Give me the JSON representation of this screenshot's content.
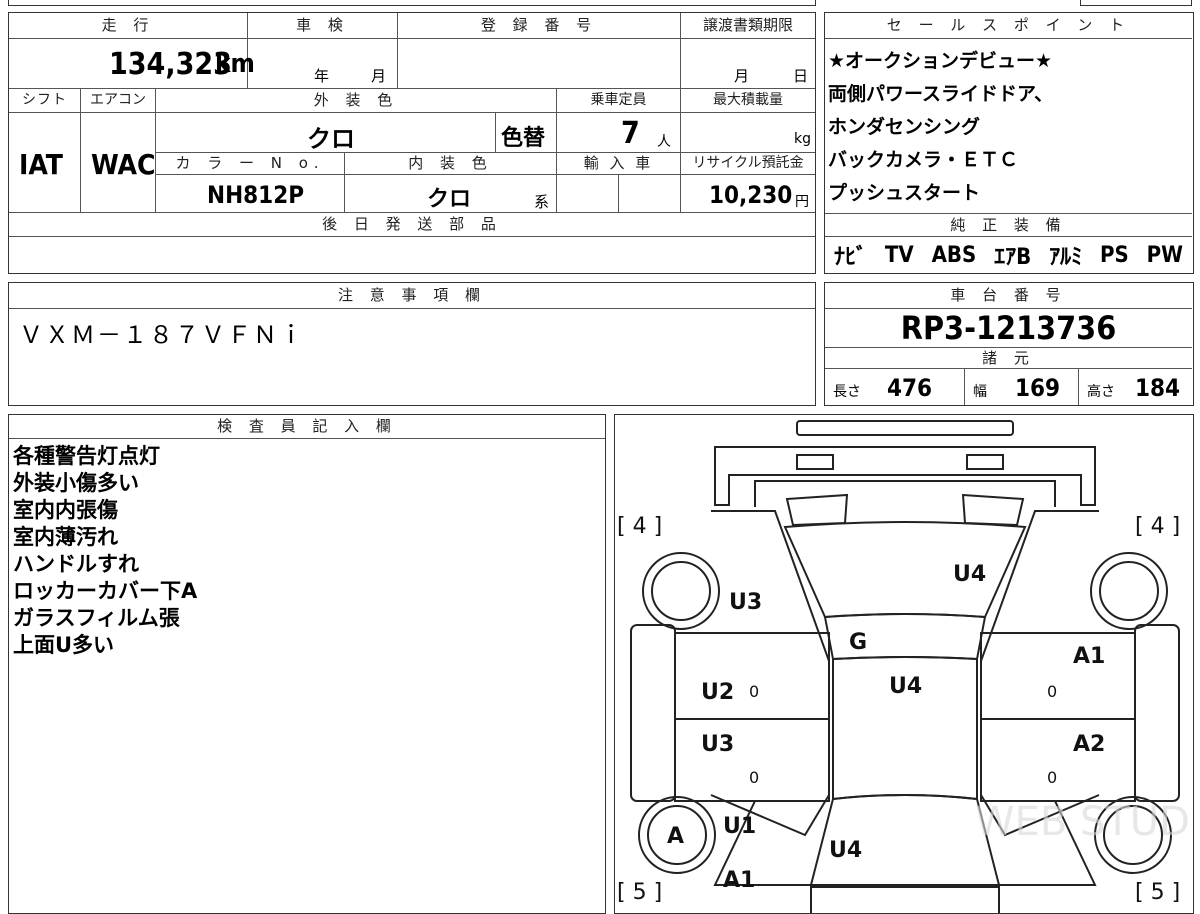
{
  "top_sheet": {
    "headers": {
      "mileage": "走 行",
      "inspection": "車 検",
      "registration": "登 録 番 号",
      "transfer_deadline": "譲渡書類期限",
      "shift": "シフト",
      "aircon": "エアコン",
      "exterior_color": "外 装 色",
      "capacity": "乗車定員",
      "max_load": "最大積載量",
      "color_no": "カ ラ ー N o.",
      "interior_color": "内 装 色",
      "import": "輸 入 車",
      "recycle": "リサイクル預託金",
      "later_parts": "後 日 発 送 部 品"
    },
    "mileage_value": "134,323",
    "mileage_unit": "km",
    "inspection_year": "年",
    "inspection_month": "月",
    "transfer_month": "月",
    "transfer_day": "日",
    "shift_value": "IAT",
    "aircon_value": "WAC",
    "exterior_value": "クロ",
    "color_change": "色替",
    "capacity_value": "7",
    "capacity_unit": "人",
    "max_load_unit": "kg",
    "color_no_value": "NH812P",
    "interior_value": "クロ",
    "interior_suffix": "系",
    "recycle_value": "10,230",
    "recycle_unit": "円"
  },
  "sales_points": {
    "header": "セ ー ル ス ポ イ ン ト",
    "lines": [
      "★オークションデビュー★",
      "両側パワースライドドア、",
      "ホンダセンシング",
      "バックカメラ・ＥＴＣ",
      "プッシュスタート"
    ]
  },
  "equipment": {
    "header": "純 正 装 備",
    "items": [
      "ﾅﾋﾞ",
      "TV",
      "ABS",
      "ｴｱB",
      "ｱﾙﾐ",
      "PS",
      "PW"
    ]
  },
  "caution": {
    "header": "注 意 事 項 欄",
    "text": "ＶＸＭ－１８７ＶＦＮｉ"
  },
  "chassis": {
    "header": "車 台 番 号",
    "value": "RP3-1213736"
  },
  "specs": {
    "header": "諸 元",
    "length_label": "長さ",
    "length_value": "476",
    "width_label": "幅",
    "width_value": "169",
    "height_label": "高さ",
    "height_value": "184"
  },
  "inspector": {
    "header": "検 査 員 記 入 欄",
    "lines": [
      "各種警告灯点灯",
      "外装小傷多い",
      "室内内張傷",
      "室内薄汚れ",
      "ハンドルすれ",
      "ロッカーカバー下A",
      "ガラスフィルム張",
      "上面U多い"
    ]
  },
  "diagram": {
    "tire_marks": [
      "[ 4 ]",
      "[ 4 ]",
      "[ 5 ]",
      "[ 5 ]"
    ],
    "marks": {
      "roof": "U4",
      "left_front": "U3",
      "hood": "G",
      "right_front": "A1",
      "left_door_front": "U2",
      "left_door_front_num": "0",
      "center": "U4",
      "right_door_front_num": "0",
      "left_door_rear": "U3",
      "left_door_rear_num": "0",
      "right_door_rear": "A2",
      "right_door_rear_num": "0",
      "left_wheel": "A",
      "left_rear": "U1",
      "rear": "U4",
      "left_bottom": "A1"
    },
    "watermark": "WEB STUDIO PRO"
  }
}
